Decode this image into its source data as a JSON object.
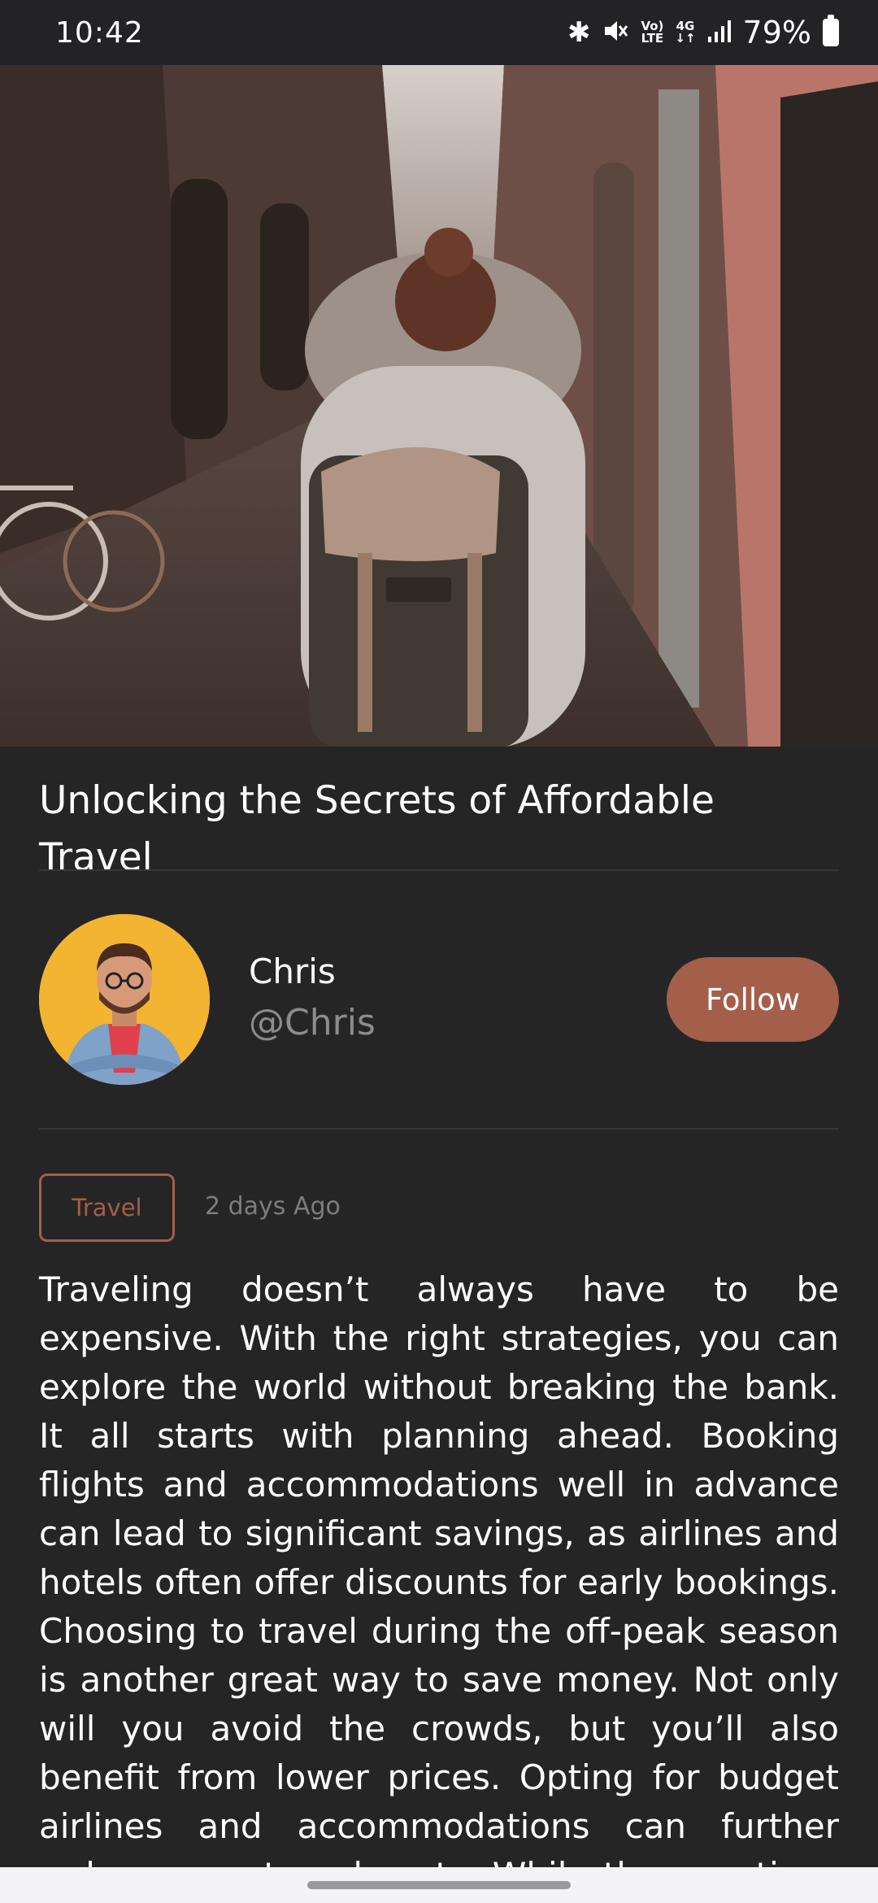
{
  "status_bar": {
    "time": "10:42",
    "bluetooth_icon": "✱",
    "mute_icon": "🔇",
    "volte_top": "Vo)",
    "volte_bottom": "LTE",
    "network_top": "4G",
    "network_bottom": "↓↑",
    "signal_icon": "▁▃▅▇",
    "battery_percent": "79%"
  },
  "hero": {
    "image_icon": "travel-photo-woman-with-backpack-in-alley"
  },
  "article": {
    "title": "Unlocking the Secrets of Affordable Travel",
    "tag": "Travel",
    "posted": "2 days Ago",
    "body": "Traveling doesn’t always have to be expensive. With the right strategies, you can explore the world without breaking the bank. It all starts with planning ahead. Booking flights and accommodations well in advance can lead to significant savings, as airlines and hotels often offer discounts for early bookings. Choosing to travel during the off-peak season is another great way to save money. Not only will you avoid the crowds, but you’ll also benefit from lower prices. Opting for budget airlines and accommodations can further reduce your travel costs. While these options may not offer the"
  },
  "author": {
    "name": "Chris",
    "handle": "@Chris",
    "follow_label": "Follow"
  },
  "colors": {
    "background": "#262526",
    "accent": "#a35f4a",
    "avatar_bg": "#f3b431",
    "muted_text": "#8c8b8d"
  }
}
